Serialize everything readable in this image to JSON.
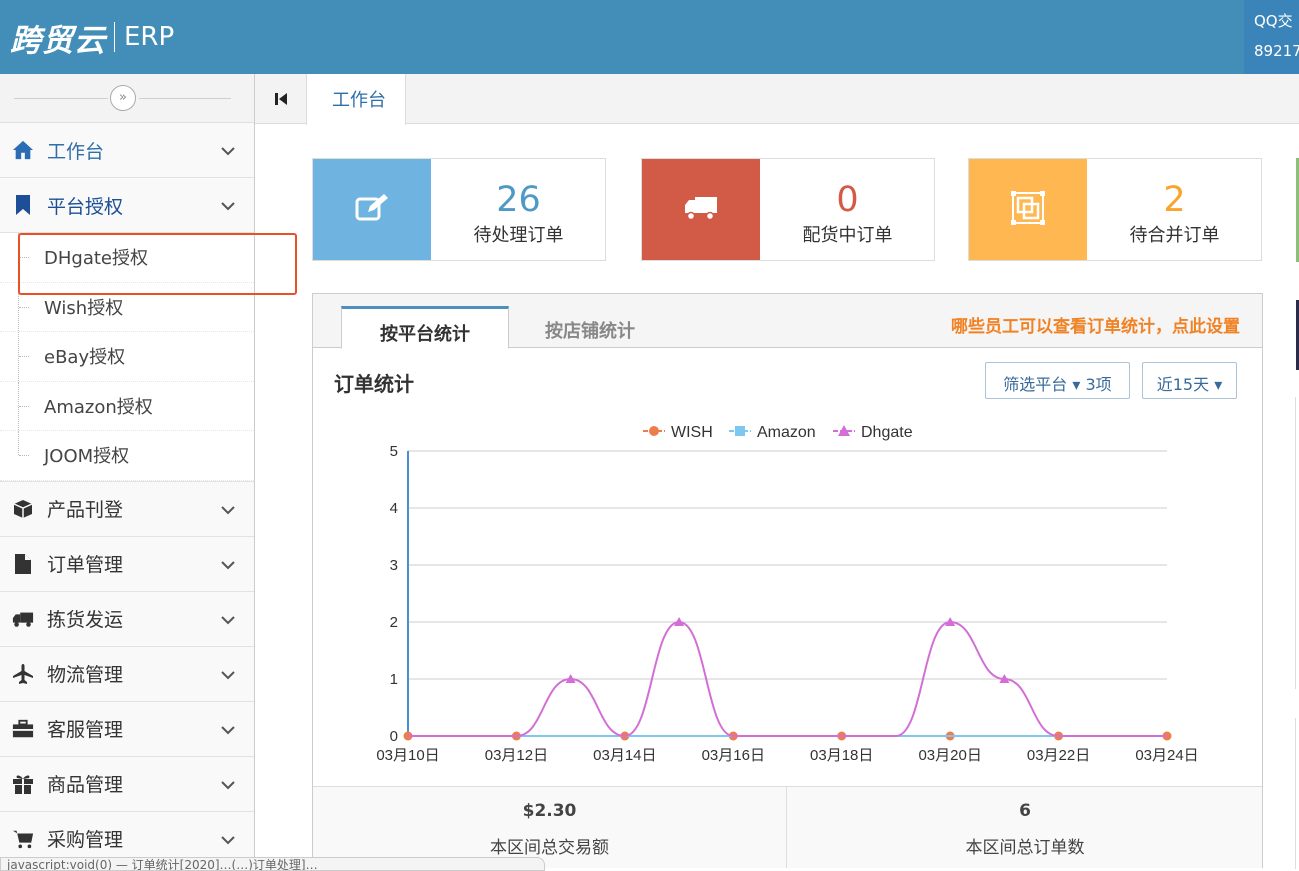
{
  "header": {
    "logo": "跨贸云",
    "logo_sub": "ERP",
    "qq_line1": "QQ交",
    "qq_line2": "89217"
  },
  "sidebar": {
    "items": [
      {
        "label": "工作台",
        "icon": "home-icon"
      },
      {
        "label": "平台授权",
        "icon": "bookmark-icon"
      },
      {
        "label": "产品刊登",
        "icon": "cube-icon"
      },
      {
        "label": "订单管理",
        "icon": "file-icon"
      },
      {
        "label": "拣货发运",
        "icon": "truck-icon"
      },
      {
        "label": "物流管理",
        "icon": "plane-icon"
      },
      {
        "label": "客服管理",
        "icon": "briefcase-icon"
      },
      {
        "label": "商品管理",
        "icon": "gift-icon"
      },
      {
        "label": "采购管理",
        "icon": "cart-icon"
      }
    ],
    "sub_items": [
      "DHgate授权",
      "Wish授权",
      "eBay授权",
      "Amazon授权",
      "JOOM授权"
    ]
  },
  "tabs": {
    "active": "工作台"
  },
  "cards": [
    {
      "num": "26",
      "label": "待处理订单",
      "color": "#6fb3e0",
      "num_color": "#4f99c6",
      "icon": "edit-icon"
    },
    {
      "num": "0",
      "label": "配货中订单",
      "color": "#d15b47",
      "num_color": "#d15b47",
      "icon": "truck-icon"
    },
    {
      "num": "2",
      "label": "待合并订单",
      "color": "#ffb752",
      "num_color": "#f9a52d",
      "icon": "merge-icon"
    }
  ],
  "panel": {
    "tab_platform": "按平台统计",
    "tab_store": "按店铺统计",
    "settings_link": "哪些员工可以查看订单统计，点此设置",
    "title": "订单统计",
    "filter_btn": "筛选平台 ▾ 3项",
    "range_btn": "近15天 ▾",
    "total_amount": "$2.30",
    "total_amount_label": "本区间总交易额",
    "total_orders": "6",
    "total_orders_label": "本区间总订单数"
  },
  "chart_data": {
    "type": "line",
    "x": [
      "03月10日",
      "03月11日",
      "03月12日",
      "03月13日",
      "03月14日",
      "03月15日",
      "03月16日",
      "03月17日",
      "03月18日",
      "03月19日",
      "03月20日",
      "03月21日",
      "03月22日",
      "03月23日",
      "03月24日"
    ],
    "x_tick_labels": [
      "03月10日",
      "03月12日",
      "03月14日",
      "03月16日",
      "03月18日",
      "03月20日",
      "03月22日",
      "03月24日"
    ],
    "ylim": [
      0,
      5
    ],
    "y_ticks": [
      0,
      1,
      2,
      3,
      4,
      5
    ],
    "legend_position": "top-center",
    "grid": true,
    "series": [
      {
        "name": "WISH",
        "color": "#ed7e4c",
        "marker": "circle",
        "values": [
          0,
          0,
          0,
          0,
          0,
          0,
          0,
          0,
          0,
          0,
          0,
          0,
          0,
          0,
          0
        ]
      },
      {
        "name": "Amazon",
        "color": "#7ec7ef",
        "marker": "square",
        "values": [
          0,
          0,
          0,
          0,
          0,
          0,
          0,
          0,
          0,
          0,
          0,
          0,
          0,
          0,
          0
        ]
      },
      {
        "name": "Dhgate",
        "color": "#d36ed6",
        "marker": "triangle",
        "values": [
          0,
          0,
          0,
          1,
          0,
          2,
          0,
          0,
          0,
          0,
          2,
          1,
          0,
          0,
          0
        ]
      }
    ]
  },
  "status_text": "javascript:void(0) — 订单统计[2020]…(…)订单处理]…"
}
